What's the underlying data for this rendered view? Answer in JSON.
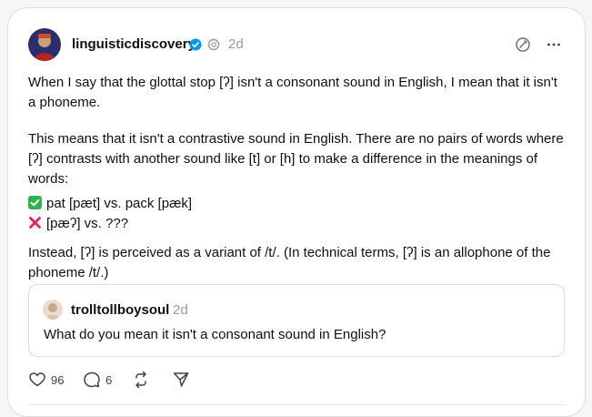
{
  "post": {
    "author": "linguisticdiscovery",
    "verified_icon": "verified-badge-icon",
    "time": "2d",
    "paragraphs": [
      "When I say that the glottal stop [ʔ] isn't a consonant sound in English, I mean that it isn't a phoneme.",
      "This means that it isn't a contrastive sound in English. There are no pairs of words where [ʔ] contrasts with another sound like [t] or [h] to make a difference in the meanings of words:"
    ],
    "list": [
      {
        "icon": "check-mark-icon",
        "text": "pat [pæt] vs. pack [pæk]"
      },
      {
        "icon": "cross-mark-icon",
        "text": "[pæʔ] vs. ???"
      }
    ],
    "closing": "Instead, [ʔ] is perceived as a variant of /t/. (In technical terms, [ʔ] is an allophone of the phoneme /t/.)"
  },
  "quote": {
    "author": "trolltollboysoul",
    "time": "2d",
    "text": "What do you mean it isn't a consonant sound in English?"
  },
  "actions": {
    "likes": "96",
    "replies": "6"
  },
  "colors": {
    "accent_blue": "#0095f6",
    "check_green": "#2fb34a",
    "cross_red": "#e0245e",
    "muted": "#999999"
  }
}
